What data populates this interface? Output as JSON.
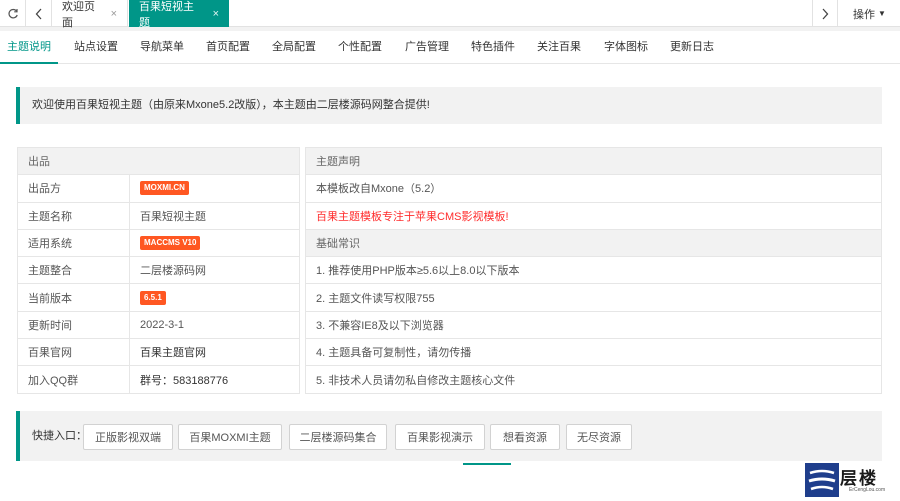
{
  "topbar": {
    "tabs": [
      {
        "label": "欢迎页面",
        "closable": true,
        "active": false
      },
      {
        "label": "百果短视主题",
        "closable": true,
        "active": true
      }
    ],
    "close_glyph": "×",
    "ops_label": "操作",
    "icons": {
      "refresh": "refresh-icon",
      "prev": "chevron-left-icon",
      "next": "chevron-right-icon",
      "ops_caret": "caret-down-icon"
    }
  },
  "nav": {
    "tabs": [
      "主题说明",
      "站点设置",
      "导航菜单",
      "首页配置",
      "全局配置",
      "个性配置",
      "广告管理",
      "特色插件",
      "关注百果",
      "字体图标",
      "更新日志"
    ],
    "active_index": 0
  },
  "welcome": "欢迎使用百果短视主题（由原来Mxone5.2改版），本主题由二层楼源码网整合提供!",
  "left_table": {
    "header": "出品",
    "rows": [
      {
        "label": "出品方",
        "value": "MOXMI.CN",
        "badge": true
      },
      {
        "label": "主题名称",
        "value": "百果短视主题",
        "badge": false
      },
      {
        "label": "适用系统",
        "value": "MACCMS V10",
        "badge": true
      },
      {
        "label": "主题整合",
        "value": "二层楼源码网",
        "badge": false
      },
      {
        "label": "当前版本",
        "value": "6.5.1",
        "badge": true
      },
      {
        "label": "更新时间",
        "value": "2022-3-1",
        "badge": false
      },
      {
        "label": "百果官网",
        "value": "百果主题官网",
        "badge": false
      },
      {
        "label": "加入QQ群",
        "value": "群号：583188776",
        "badge": false
      }
    ]
  },
  "right_table": {
    "rows": [
      {
        "text": "主题声明",
        "type": "header"
      },
      {
        "text": "本模板改自Mxone（5.2）",
        "type": "normal"
      },
      {
        "text": "百果主题模板专注于苹果CMS影视模板!",
        "type": "red"
      },
      {
        "text": "基础常识",
        "type": "header"
      },
      {
        "text": "1. 推荐使用PHP版本≥5.6以上8.0以下版本",
        "type": "normal"
      },
      {
        "text": "2. 主题文件读写权限755",
        "type": "normal"
      },
      {
        "text": "3. 不兼容IE8及以下浏览器",
        "type": "normal"
      },
      {
        "text": "4. 主题具备可复制性，请勿传播",
        "type": "normal"
      },
      {
        "text": "5. 非技术人员请勿私自修改主题核心文件",
        "type": "normal"
      }
    ]
  },
  "quick": {
    "label": "快捷入口：",
    "buttons": [
      "正版影视双端",
      "百果MOXMI主题",
      "二层楼源码集合",
      "百果影视演示",
      "想看资源",
      "无尽资源"
    ]
  },
  "watermark": {
    "name": "层楼",
    "sub": "ErCengLou.com"
  },
  "colors": {
    "accent": "#009688",
    "badge": "#ff5722",
    "notice_red": "#ff2d2d"
  }
}
